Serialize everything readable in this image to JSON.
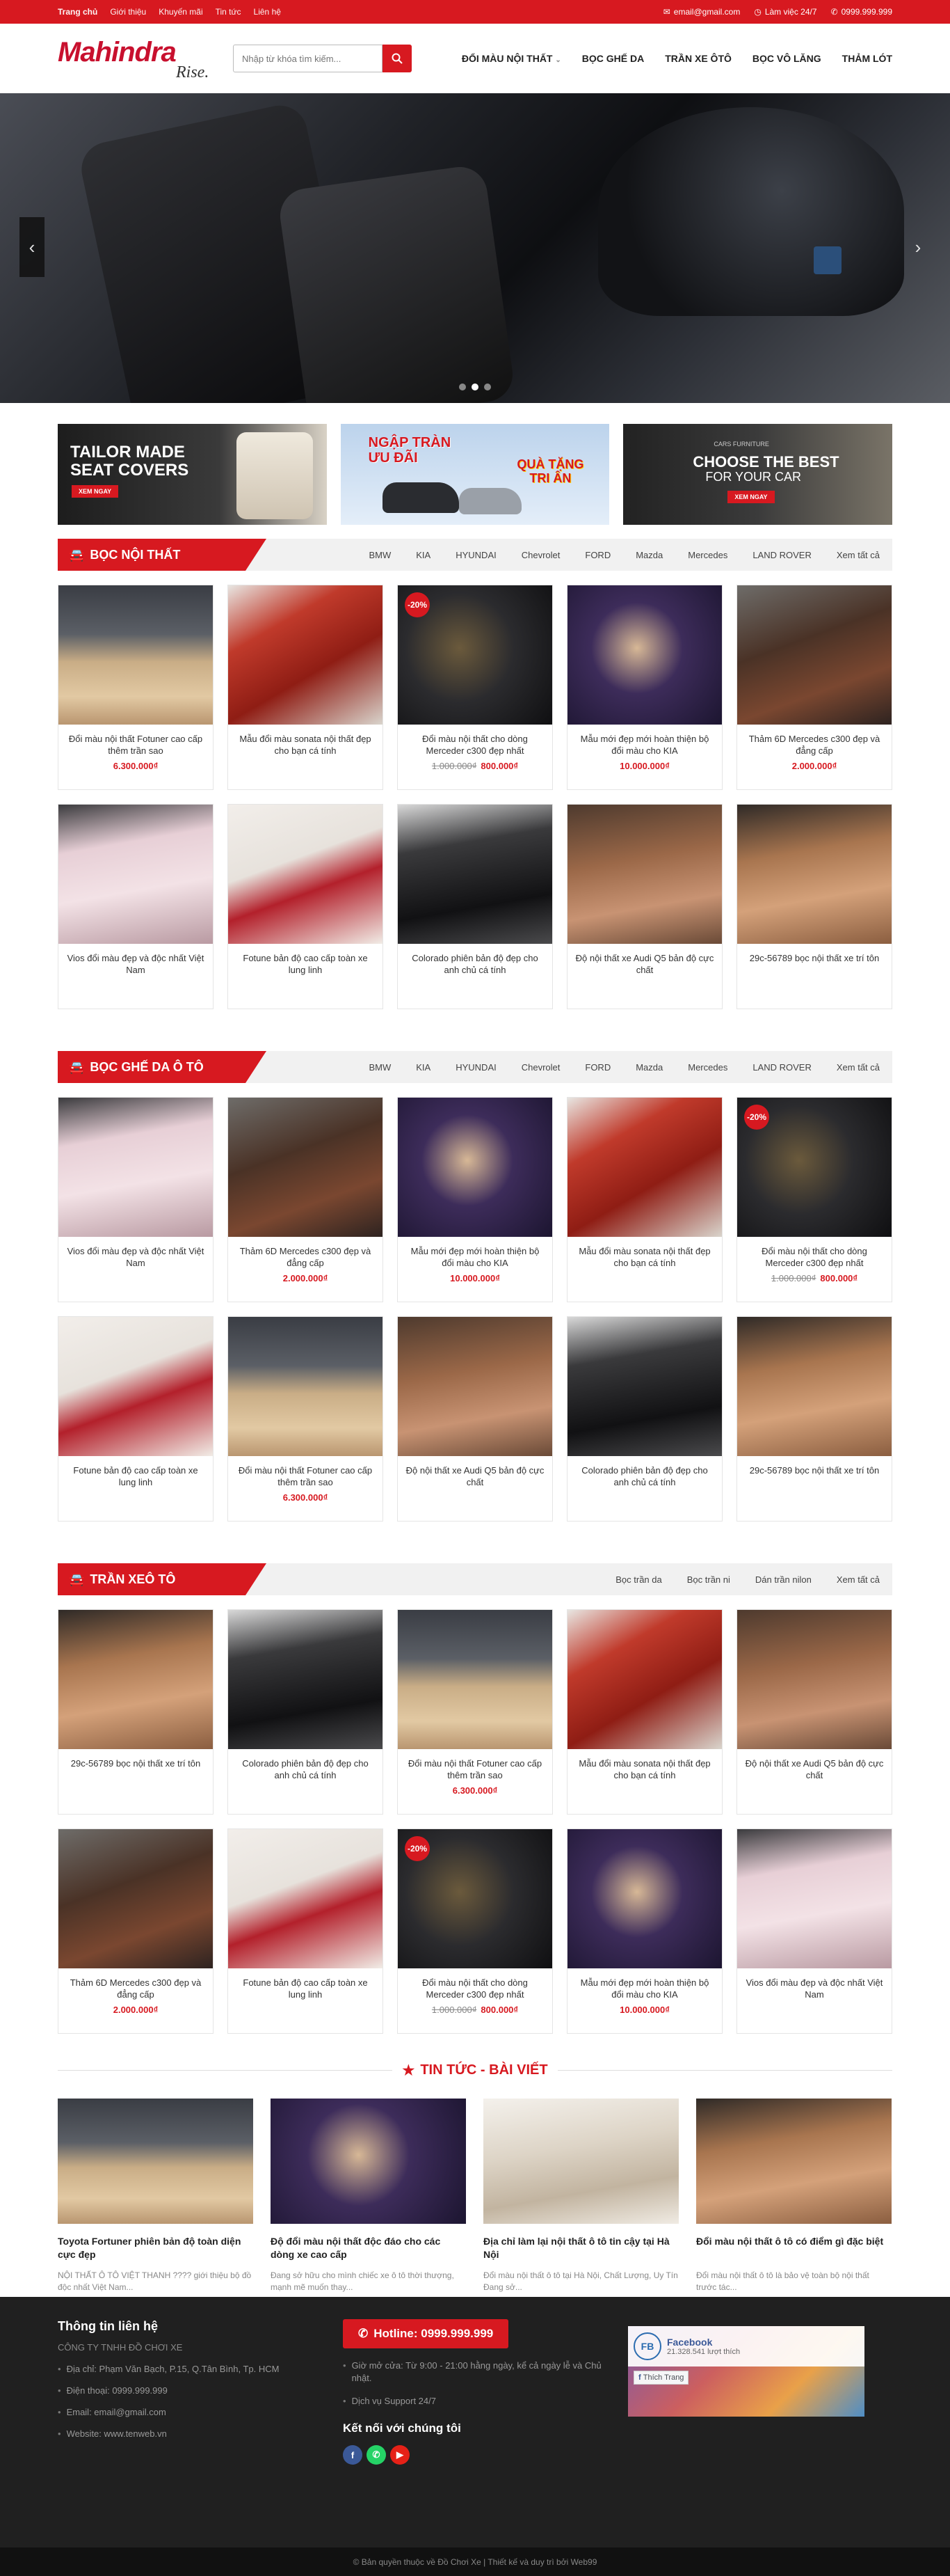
{
  "topbar": {
    "links": [
      "Trang chủ",
      "Giới thiệu",
      "Khuyến mãi",
      "Tin tức",
      "Liên hệ"
    ],
    "email": "email@gmail.com",
    "hours": "Làm việc 24/7",
    "phone": "0999.999.999"
  },
  "header": {
    "logo_brand": "Mahindra",
    "logo_tag": "Rise.",
    "search_placeholder": "Nhập từ khóa tìm kiếm...",
    "nav": [
      "ĐỔI MÀU NỘI THẤT",
      "BỌC GHẾ DA",
      "TRẦN XE ÔTÔ",
      "BỌC VÔ LĂNG",
      "THẢM LÓT"
    ]
  },
  "slider": {
    "active_dot": 1,
    "dot_count": 3
  },
  "banners": {
    "b1_title": "TAILOR MADE SEAT COVERS",
    "b1_btn": "XEM NGAY",
    "b2_title1": "NGẬP TRÀN ƯU ĐÃI",
    "b2_title2": "QUÀ TẶNG TRI ÂN",
    "b3_small": "CARS FURNITURE",
    "b3_title": "CHOOSE THE BEST",
    "b3_sub": "FOR YOUR CAR",
    "b3_btn": "XEM NGAY"
  },
  "sections": [
    {
      "title": "BỌC NỘI THẤT",
      "tabs": [
        "BMW",
        "KIA",
        "HYUNDAI",
        "Chevrolet",
        "FORD",
        "Mazda",
        "Mercedes",
        "LAND ROVER",
        "Xem tất cả"
      ],
      "products": [
        {
          "name": "Đổi màu nội thất Fotuner cao cấp thêm trần sao",
          "price": "6.300.000₫",
          "old": "",
          "sale": "",
          "tone": "beige"
        },
        {
          "name": "Mẫu đổi màu sonata nội thất đẹp cho bạn cá tính",
          "price": "",
          "old": "",
          "sale": "",
          "tone": "red"
        },
        {
          "name": "Đổi màu nội thất cho dòng Merceder c300 đẹp nhất",
          "price": "800.000₫",
          "old": "1.000.000₫",
          "sale": "-20%",
          "tone": "dash"
        },
        {
          "name": "Mẫu mới đẹp mới hoàn thiện bộ đổi màu cho KIA",
          "price": "10.000.000₫",
          "old": "",
          "sale": "",
          "tone": "purple"
        },
        {
          "name": "Thảm 6D Mercedes c300 đẹp và đẳng cấp",
          "price": "2.000.000₫",
          "old": "",
          "sale": "",
          "tone": "mat"
        },
        {
          "name": "Vios đổi màu đẹp và độc nhất Việt Nam",
          "price": "",
          "old": "",
          "sale": "",
          "tone": "pink"
        },
        {
          "name": "Fotune bản độ cao cấp toàn xe lung linh",
          "price": "",
          "old": "",
          "sale": "",
          "tone": "whitered"
        },
        {
          "name": "Colorado phiên bản độ đẹp cho anh chủ cá tính",
          "price": "",
          "old": "",
          "sale": "",
          "tone": "black"
        },
        {
          "name": "Độ nội thất xe Audi Q5 bản độ cực chất",
          "price": "",
          "old": "",
          "sale": "",
          "tone": "brown"
        },
        {
          "name": "29c-56789 bọc nội thất xe trí tôn",
          "price": "",
          "old": "",
          "sale": "",
          "tone": "tan"
        }
      ]
    },
    {
      "title": "BỌC GHẾ DA Ô TÔ",
      "tabs": [
        "BMW",
        "KIA",
        "HYUNDAI",
        "Chevrolet",
        "FORD",
        "Mazda",
        "Mercedes",
        "LAND ROVER",
        "Xem tất cả"
      ],
      "products": [
        {
          "name": "Vios đổi màu đẹp và độc nhất Việt Nam",
          "price": "",
          "old": "",
          "sale": "",
          "tone": "pink"
        },
        {
          "name": "Thảm 6D Mercedes c300 đẹp và đẳng cấp",
          "price": "2.000.000₫",
          "old": "",
          "sale": "",
          "tone": "mat"
        },
        {
          "name": "Mẫu mới đẹp mới hoàn thiện bộ đổi màu cho KIA",
          "price": "10.000.000₫",
          "old": "",
          "sale": "",
          "tone": "purple"
        },
        {
          "name": "Mẫu đổi màu sonata nội thất đẹp cho bạn cá tính",
          "price": "",
          "old": "",
          "sale": "",
          "tone": "red"
        },
        {
          "name": "Đổi màu nội thất cho dòng Merceder c300 đẹp nhất",
          "price": "800.000₫",
          "old": "1.000.000₫",
          "sale": "-20%",
          "tone": "dash"
        },
        {
          "name": "Fotune bản độ cao cấp toàn xe lung linh",
          "price": "",
          "old": "",
          "sale": "",
          "tone": "whitered"
        },
        {
          "name": "Đổi màu nội thất Fotuner cao cấp thêm trần sao",
          "price": "6.300.000₫",
          "old": "",
          "sale": "",
          "tone": "beige"
        },
        {
          "name": "Độ nội thất xe Audi Q5 bản độ cực chất",
          "price": "",
          "old": "",
          "sale": "",
          "tone": "brown"
        },
        {
          "name": "Colorado phiên bản độ đẹp cho anh chủ cá tính",
          "price": "",
          "old": "",
          "sale": "",
          "tone": "black"
        },
        {
          "name": "29c-56789 bọc nội thất xe trí tôn",
          "price": "",
          "old": "",
          "sale": "",
          "tone": "tan"
        }
      ]
    },
    {
      "title": "TRẦN XEÔ TÔ",
      "tabs": [
        "Bọc trần da",
        "Bọc trần ni",
        "Dán trần nilon",
        "Xem tất cả"
      ],
      "products": [
        {
          "name": "29c-56789 bọc nội thất xe trí tôn",
          "price": "",
          "old": "",
          "sale": "",
          "tone": "tan"
        },
        {
          "name": "Colorado phiên bản độ đẹp cho anh chủ cá tính",
          "price": "",
          "old": "",
          "sale": "",
          "tone": "black"
        },
        {
          "name": "Đổi màu nội thất Fotuner cao cấp thêm trần sao",
          "price": "6.300.000₫",
          "old": "",
          "sale": "",
          "tone": "beige"
        },
        {
          "name": "Mẫu đổi màu sonata nội thất đẹp cho bạn cá tính",
          "price": "",
          "old": "",
          "sale": "",
          "tone": "red"
        },
        {
          "name": "Độ nội thất xe Audi Q5 bản độ cực chất",
          "price": "",
          "old": "",
          "sale": "",
          "tone": "brown"
        },
        {
          "name": "Thảm 6D Mercedes c300 đẹp và đẳng cấp",
          "price": "2.000.000₫",
          "old": "",
          "sale": "",
          "tone": "mat"
        },
        {
          "name": "Fotune bản độ cao cấp toàn xe lung linh",
          "price": "",
          "old": "",
          "sale": "",
          "tone": "whitered"
        },
        {
          "name": "Đổi màu nội thất cho dòng Merceder c300 đẹp nhất",
          "price": "800.000₫",
          "old": "1.000.000₫",
          "sale": "-20%",
          "tone": "dash"
        },
        {
          "name": "Mẫu mới đẹp mới hoàn thiện bộ đổi màu cho KIA",
          "price": "10.000.000₫",
          "old": "",
          "sale": "",
          "tone": "purple"
        },
        {
          "name": "Vios đổi màu đẹp và độc nhất Việt Nam",
          "price": "",
          "old": "",
          "sale": "",
          "tone": "pink"
        }
      ]
    }
  ],
  "news": {
    "title": "TIN TỨC - BÀI VIẾT",
    "items": [
      {
        "title": "Toyota Fortuner phiên bản độ toàn diện cực đẹp",
        "desc": "NỘI THẤT Ô TÔ VIỆT THANH ???? giới thiệu bộ đồ độc nhất Việt Nam...",
        "tone": "beige"
      },
      {
        "title": "Độ đổi màu nội thất độc đáo cho các dòng xe cao cấp",
        "desc": "Đang sở hữu cho mình chiếc xe ô tô thời thượng, mạnh mẽ muốn thay...",
        "tone": "purple"
      },
      {
        "title": "Địa chỉ làm lại nội thất ô tô tin cậy tại Hà Nội",
        "desc": "Đổi màu nội thất ô tô tại Hà Nội, Chất Lượng, Uy Tín Đang sở...",
        "tone": "white"
      },
      {
        "title": "Đổi màu nội thất ô tô có điểm gì đặc biệt",
        "desc": "Đổi màu nội thất ô tô là bảo vệ toàn bộ nội thất trước tác...",
        "tone": "tan"
      }
    ]
  },
  "footer": {
    "contact_title": "Thông tin liên hệ",
    "company": "CÔNG TY TNHH ĐỒ CHƠI XE",
    "address": "Địa chỉ: Phạm Văn Bạch, P.15, Q.Tân Bình, Tp. HCM",
    "phone": "Điện thoại: 0999.999.999",
    "email": "Email: email@gmail.com",
    "website": "Website: www.tenweb.vn",
    "hotline": "Hotline: 0999.999.999",
    "open": "Giờ mở cửa: Từ 9:00 - 21:00 hằng ngày, kể cả ngày lễ và Chủ nhật.",
    "support": "Dịch vụ Support 24/7",
    "social_title": "Kết nối với chúng tôi",
    "fb_name": "Facebook",
    "fb_likes": "21.328.541 lượt thích",
    "fb_btn": "Thích Trang",
    "copyright": "© Bản quyền thuộc về Đồ Chơi Xe | Thiết kế và duy trì bởi Web99"
  },
  "colors": {
    "accent": "#d71920",
    "footer": "#202020"
  }
}
